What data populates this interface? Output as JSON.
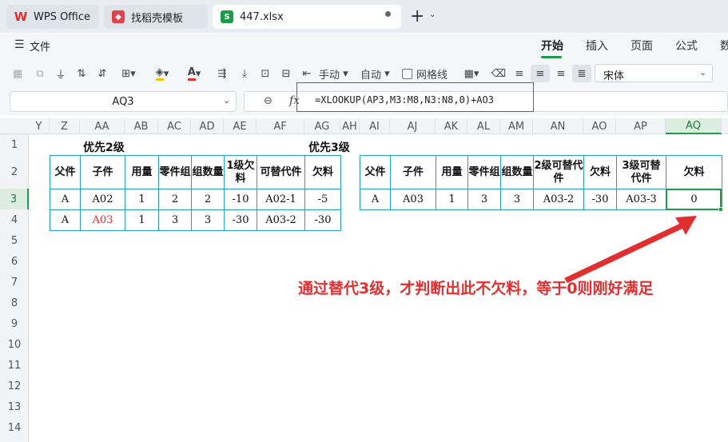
{
  "tabs": [
    {
      "label": "WPS Office",
      "icon": "wps-logo-icon"
    },
    {
      "label": "找稻壳模板",
      "icon": "docer-logo-icon"
    },
    {
      "label": "447.xlsx",
      "icon": "spreadsheet-s-icon"
    }
  ],
  "menu": {
    "file_label": "文件",
    "ribbon_tabs": [
      "开始",
      "插入",
      "页面",
      "公式",
      "数"
    ]
  },
  "toolbar": {
    "wrap_label": "手动",
    "auto_label": "自动",
    "gridlines_label": "网格线",
    "font_name": "宋体"
  },
  "formula_bar": {
    "cell_ref": "AQ3",
    "fx_label": "fx",
    "formula": "=XLOOKUP(AP3,M3:M8,N3:N8,0)+AO3"
  },
  "grid": {
    "columns": [
      "Y",
      "Z",
      "AA",
      "AB",
      "AC",
      "AD",
      "AE",
      "AF",
      "AG",
      "AH",
      "AI",
      "AJ",
      "AK",
      "AL",
      "AM",
      "AN",
      "AO",
      "AP",
      "AQ"
    ],
    "rows": [
      "1",
      "2",
      "3",
      "4",
      "5",
      "6",
      "7",
      "8",
      "9",
      "10",
      "11",
      "12",
      "13",
      "14"
    ],
    "selected_column": "AQ",
    "selected_row": "3"
  },
  "table_left": {
    "title": "优先2级",
    "headers": [
      "父件",
      "子件",
      "用量",
      "零件组",
      "组数量",
      "1级欠料",
      "可替代件",
      "欠料"
    ],
    "rows": [
      [
        "A",
        "A02",
        "1",
        "2",
        "2",
        "-10",
        "A02-1",
        "-5"
      ],
      [
        "A",
        "A03",
        "1",
        "3",
        "3",
        "-30",
        "A03-2",
        "-30"
      ]
    ]
  },
  "table_right": {
    "title": "优先3级",
    "headers": [
      "父件",
      "子件",
      "用量",
      "零件组",
      "组数量",
      "2级可替代件",
      "欠料",
      "3级可替代件",
      "欠料"
    ],
    "rows": [
      [
        "A",
        "A03",
        "1",
        "3",
        "3",
        "A03-2",
        "-30",
        "A03-3",
        "0"
      ]
    ]
  },
  "annotation": "通过替代3级，才判断出此不欠料，等于0则刚好满足",
  "colors": {
    "accent_green": "#1e9a4a",
    "table_border": "#26a0c4",
    "annotation_red": "#e12e2e"
  }
}
